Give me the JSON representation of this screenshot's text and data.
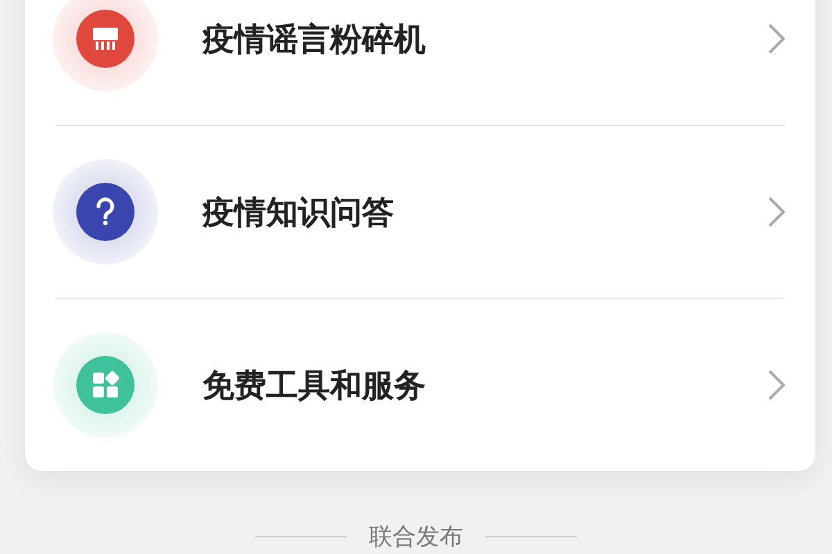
{
  "menu": {
    "items": [
      {
        "kind": "shredder",
        "label": "疫情谣言粉碎机",
        "color": "#e0473d"
      },
      {
        "kind": "question",
        "label": "疫情知识问答",
        "color": "#3a45ad"
      },
      {
        "kind": "apps",
        "label": "免费工具和服务",
        "color": "#3fc29b"
      }
    ]
  },
  "footer": {
    "label": "联合发布"
  }
}
